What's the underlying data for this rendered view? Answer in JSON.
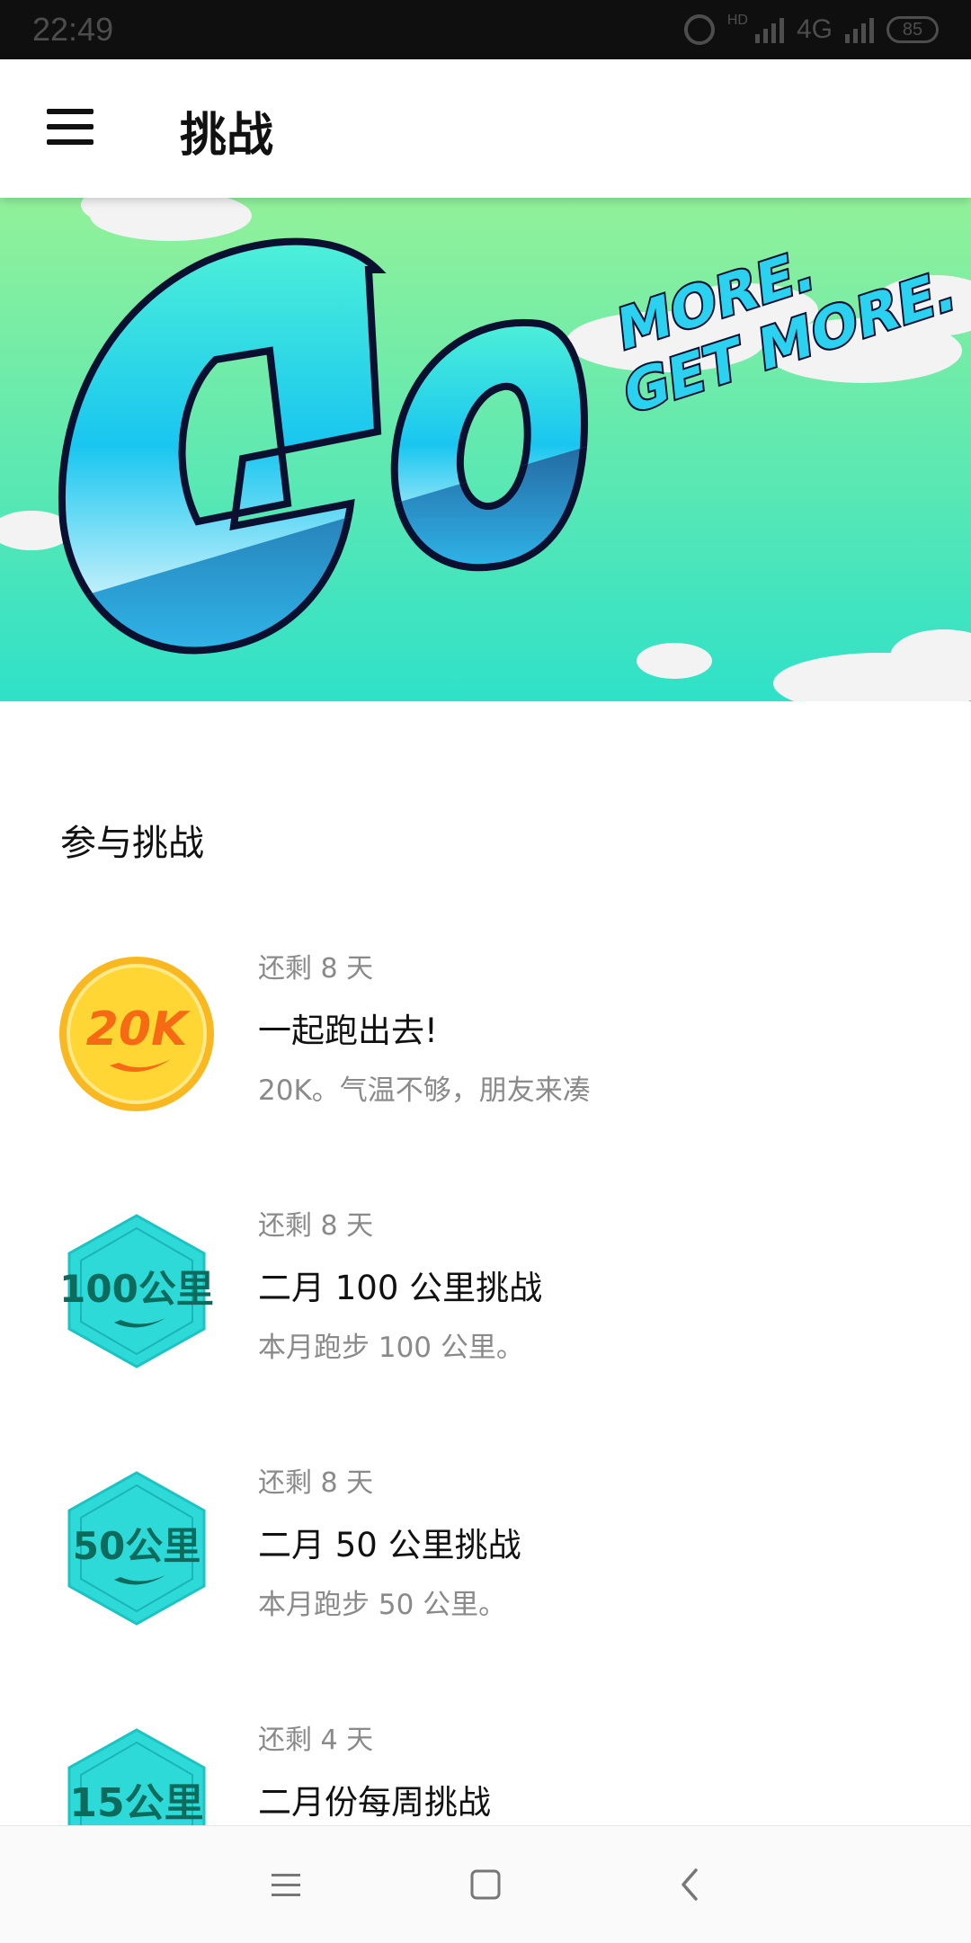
{
  "status_bar": {
    "time": "22:49",
    "hd": "HD",
    "network": "4G",
    "battery": "85"
  },
  "app_bar": {
    "title": "挑战",
    "menu_icon": "hamburger-menu-icon"
  },
  "banner": {
    "headline": "GO",
    "tagline_line1": "MORE.",
    "tagline_line2": "GET MORE.",
    "colors": {
      "sky_top": "#8ff0a0",
      "sky_bottom": "#33e2c6",
      "accent": "#1e2a78"
    }
  },
  "section": {
    "title": "参与挑战"
  },
  "challenges": [
    {
      "badge_text": "20K",
      "badge_shape": "coin",
      "remaining": "还剩 8 天",
      "title": "一起跑出去!",
      "description": "20K。气温不够，朋友来凑"
    },
    {
      "badge_text": "100公里",
      "badge_shape": "hexagon",
      "remaining": "还剩 8 天",
      "title": "二月 100 公里挑战",
      "description": "本月跑步 100 公里。"
    },
    {
      "badge_text": "50公里",
      "badge_shape": "hexagon",
      "remaining": "还剩 8 天",
      "title": "二月 50 公里挑战",
      "description": "本月跑步 50 公里。"
    },
    {
      "badge_text": "15公里",
      "badge_shape": "hexagon",
      "remaining": "还剩 4 天",
      "title": "二月份每周挑战",
      "description": ""
    }
  ],
  "nav_bar": {
    "menu_icon": "recent-apps-icon",
    "home_icon": "home-square-icon",
    "back_icon": "back-chevron-icon"
  }
}
